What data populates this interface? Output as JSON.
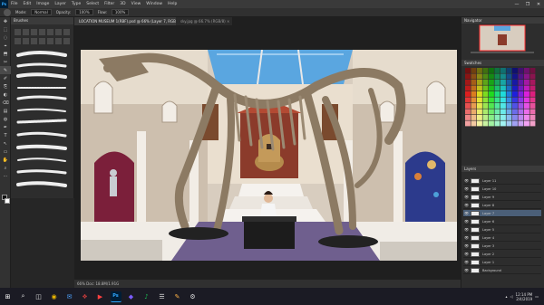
{
  "app": {
    "logo": "Ps",
    "menu": [
      "File",
      "Edit",
      "Image",
      "Layer",
      "Type",
      "Select",
      "Filter",
      "3D",
      "View",
      "Window",
      "Help"
    ],
    "window_controls": [
      "—",
      "❐",
      "✕"
    ]
  },
  "options_bar": {
    "items": [
      "Mode:",
      "Normal",
      "Opacity:",
      "100%",
      "Flow:",
      "100%"
    ]
  },
  "tools": [
    "✥",
    "⬚",
    "◌",
    "⌖",
    "⬒",
    "✂",
    "✎",
    "✐",
    "⎘",
    "◐",
    "⌫",
    "▤",
    "◍",
    "✒",
    "T",
    "↖",
    "▭",
    "✋",
    "⌕",
    "⋯"
  ],
  "brush_panel": {
    "title": "Brushes"
  },
  "document": {
    "active_tab": "LOCATION MUSEUM 1(RBF).psd @ 66% (Layer 7, RGB/8) *",
    "inactive_tab": "sky.jpg @ 66.7% (RGB/8) ×",
    "status": "66%    Doc: 18.8M/1.91G"
  },
  "right_panels": {
    "navigator_title": "Navigator",
    "swatches_title": "Swatches",
    "layers_title": "Layers",
    "layers": [
      "Layer 11",
      "Layer 10",
      "Layer 9",
      "Layer 8",
      "Layer 7",
      "Layer 6",
      "Layer 5",
      "Layer 4",
      "Layer 3",
      "Layer 2",
      "Layer 1",
      "Background"
    ]
  },
  "taskbar": {
    "icons": [
      "⊞",
      "⌕",
      "◫",
      "◉",
      "✉",
      "❖",
      "▶",
      "Ps",
      "◆",
      "♪",
      "☰",
      "✎",
      "⚙"
    ],
    "time": "12:14 PM",
    "date": "2/4/2019"
  },
  "colors": {
    "accent": "#31a8ff",
    "canvas_sky": "#5aa6e0",
    "wall": "#d9cfc1"
  }
}
